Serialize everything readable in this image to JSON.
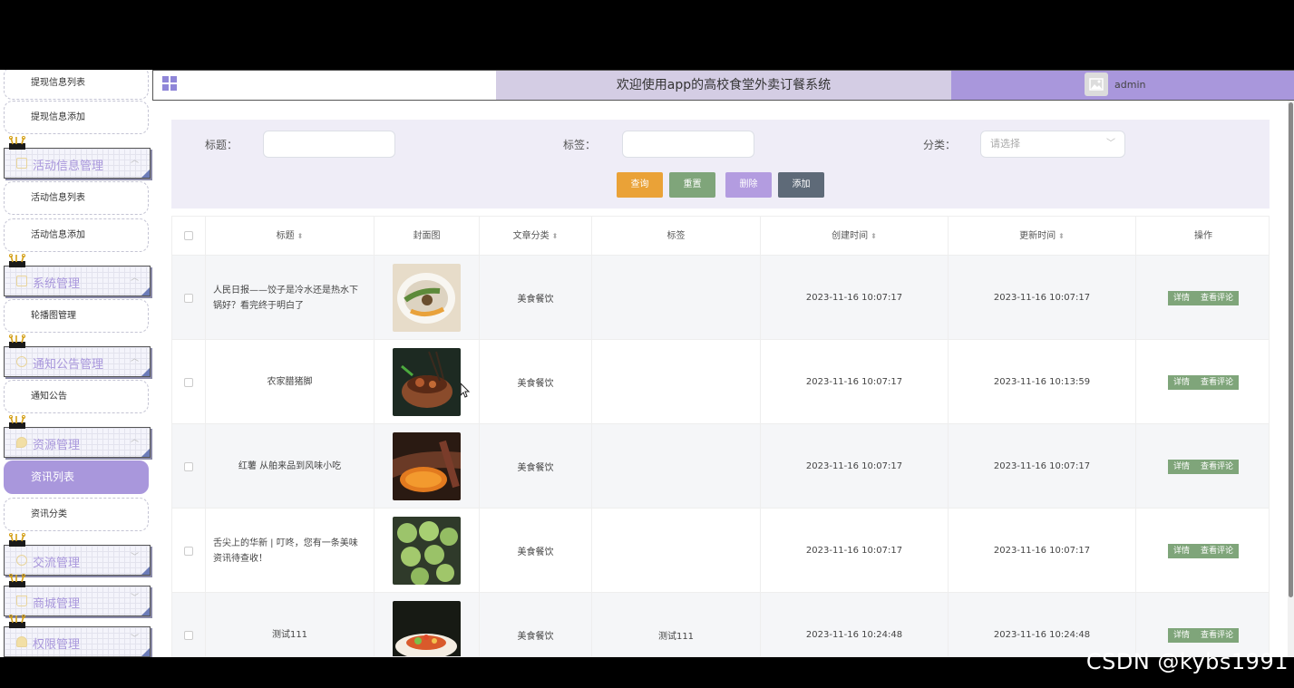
{
  "app": {
    "title": "欢迎使用app的高校食堂外卖订餐系统",
    "username": "admin"
  },
  "sidebar": {
    "items": [
      {
        "type": "sub",
        "label": "提现信息列表"
      },
      {
        "type": "sub",
        "label": "提现信息添加"
      },
      {
        "type": "menu",
        "label": "活动信息管理",
        "icon": "document-icon"
      },
      {
        "type": "sub",
        "label": "活动信息列表"
      },
      {
        "type": "sub",
        "label": "活动信息添加"
      },
      {
        "type": "menu",
        "label": "系统管理",
        "icon": "image-icon"
      },
      {
        "type": "sub",
        "label": "轮播图管理"
      },
      {
        "type": "menu",
        "label": "通知公告管理",
        "icon": "info-icon"
      },
      {
        "type": "sub",
        "label": "通知公告"
      },
      {
        "type": "menu",
        "label": "资源管理",
        "icon": "location-icon"
      },
      {
        "type": "sub",
        "label": "资讯列表",
        "active": true
      },
      {
        "type": "sub",
        "label": "资讯分类"
      },
      {
        "type": "menu",
        "label": "交流管理",
        "icon": "chat-icon"
      },
      {
        "type": "menu",
        "label": "商城管理",
        "icon": "cart-icon"
      },
      {
        "type": "menu",
        "label": "权限管理",
        "icon": "user-icon"
      }
    ]
  },
  "search": {
    "title_label": "标题：",
    "tag_label": "标签：",
    "category_label": "分类：",
    "category_placeholder": "请选择",
    "buttons": {
      "query": "查询",
      "reset": "重置",
      "delete": "删除",
      "add": "添加"
    }
  },
  "table": {
    "headers": {
      "title": "标题",
      "cover": "封面图",
      "category": "文章分类",
      "tags": "标签",
      "created": "创建时间",
      "updated": "更新时间",
      "actions": "操作"
    },
    "rows": [
      {
        "title": "人民日报——饺子是冷水还是热水下锅好？看完终于明白了",
        "category": "美食餐饮",
        "tags": "",
        "created": "2023-11-16 10:07:17",
        "updated": "2023-11-16 10:07:17"
      },
      {
        "title": "农家腊猪脚",
        "category": "美食餐饮",
        "tags": "",
        "created": "2023-11-16 10:07:17",
        "updated": "2023-11-16 10:13:59"
      },
      {
        "title": "红薯 从舶来品到风味小吃",
        "category": "美食餐饮",
        "tags": "",
        "created": "2023-11-16 10:07:17",
        "updated": "2023-11-16 10:07:17"
      },
      {
        "title": "舌尖上的华新 | 叮咚，您有一条美味资讯待查收！",
        "category": "美食餐饮",
        "tags": "",
        "created": "2023-11-16 10:07:17",
        "updated": "2023-11-16 10:07:17"
      },
      {
        "title": "测试111",
        "category": "美食餐饮",
        "tags": "测试111",
        "created": "2023-11-16 10:24:48",
        "updated": "2023-11-16 10:24:48"
      }
    ],
    "action_labels": {
      "detail": "详情",
      "comments": "查看评论"
    }
  },
  "watermark": "CSDN @kybs1991",
  "colors": {
    "accent": "#a997dc",
    "query_btn": "#eaa237",
    "reset_btn": "#7fa57a",
    "delete_btn": "#b39ce0",
    "add_btn": "#5e6a78",
    "header_center": "#d4cde4"
  }
}
